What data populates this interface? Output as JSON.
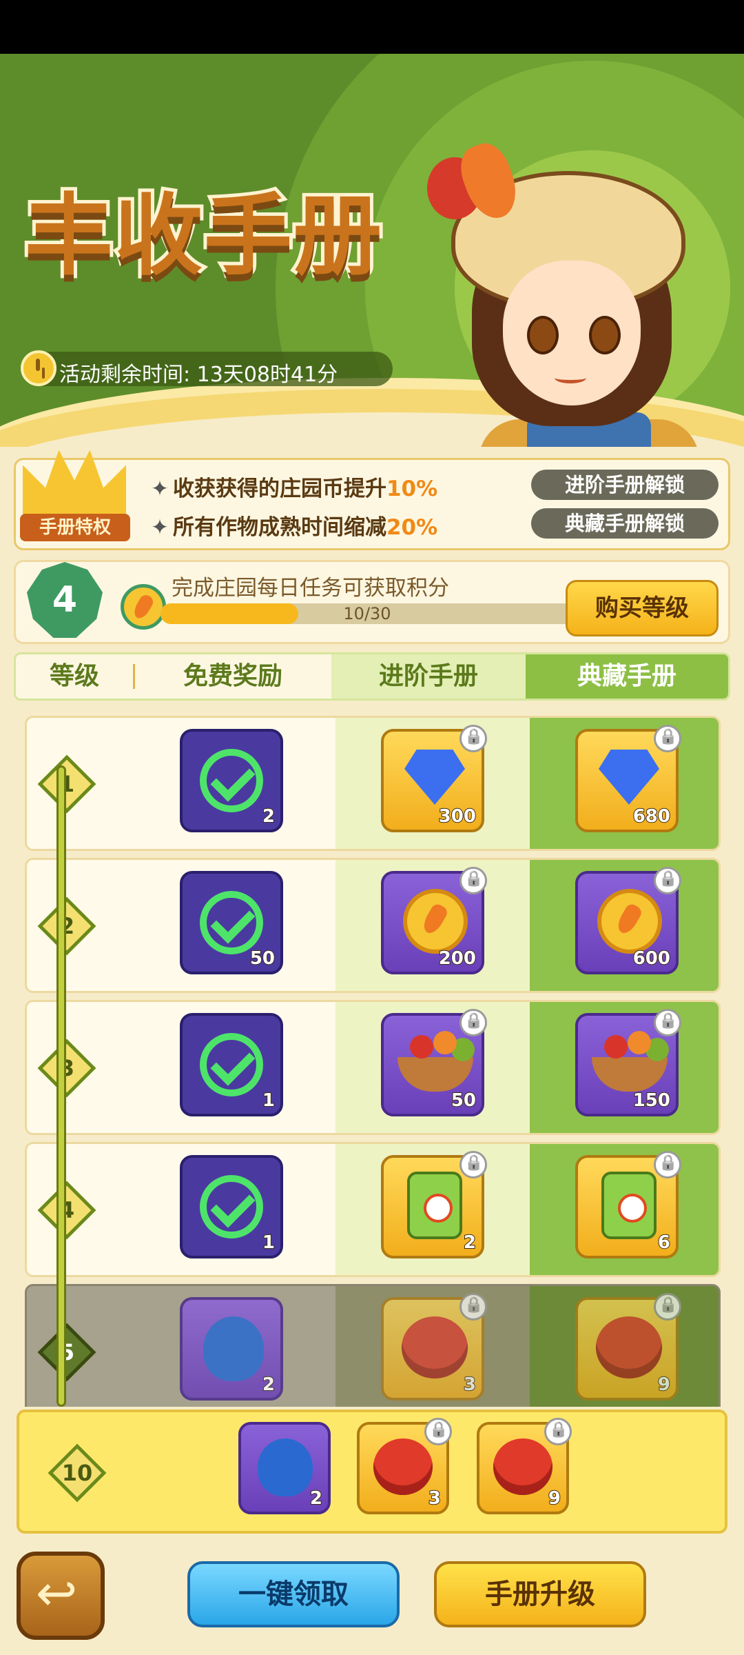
{
  "header": {
    "title": "丰收手册",
    "timer_text": "活动剩余时间: 13天08时41分"
  },
  "privilege": {
    "badge_label": "手册特权",
    "line1_prefix": "收获获得的庄园币提升",
    "line1_value": "10%",
    "line2_prefix": "所有作物成熟时间缩减",
    "line2_value": "20%",
    "unlock1": "进阶手册解锁",
    "unlock2": "典藏手册解锁"
  },
  "level": {
    "current": "4",
    "task_text": "完成庄园每日任务可获取积分",
    "progress_text": "10/30",
    "progress_fraction": 0.333,
    "buy_button": "购买等级"
  },
  "tabs": [
    "等级",
    "免费奖励",
    "进阶手册",
    "典藏手册"
  ],
  "rows": [
    {
      "level": "1",
      "free_qty": "2",
      "adv_qty": "300",
      "coll_qty": "680",
      "adv_icon": "diamond-icon",
      "locked": false
    },
    {
      "level": "2",
      "free_qty": "50",
      "adv_qty": "200",
      "coll_qty": "600",
      "adv_icon": "carrot-coin-icon",
      "locked": false
    },
    {
      "level": "3",
      "free_qty": "1",
      "adv_qty": "50",
      "coll_qty": "150",
      "adv_icon": "fruit-bowl-icon",
      "locked": false
    },
    {
      "level": "4",
      "free_qty": "1",
      "adv_qty": "2",
      "coll_qty": "6",
      "adv_icon": "sprayer-icon",
      "locked": false
    },
    {
      "level": "5",
      "free_qty": "2",
      "adv_qty": "3",
      "coll_qty": "9",
      "adv_icon": "flower-icon",
      "locked": true
    }
  ],
  "preview": {
    "level": "10",
    "free_qty": "2",
    "adv_qty": "3",
    "coll_qty": "9"
  },
  "buttons": {
    "claim_all": "一键领取",
    "upgrade": "手册升级"
  }
}
